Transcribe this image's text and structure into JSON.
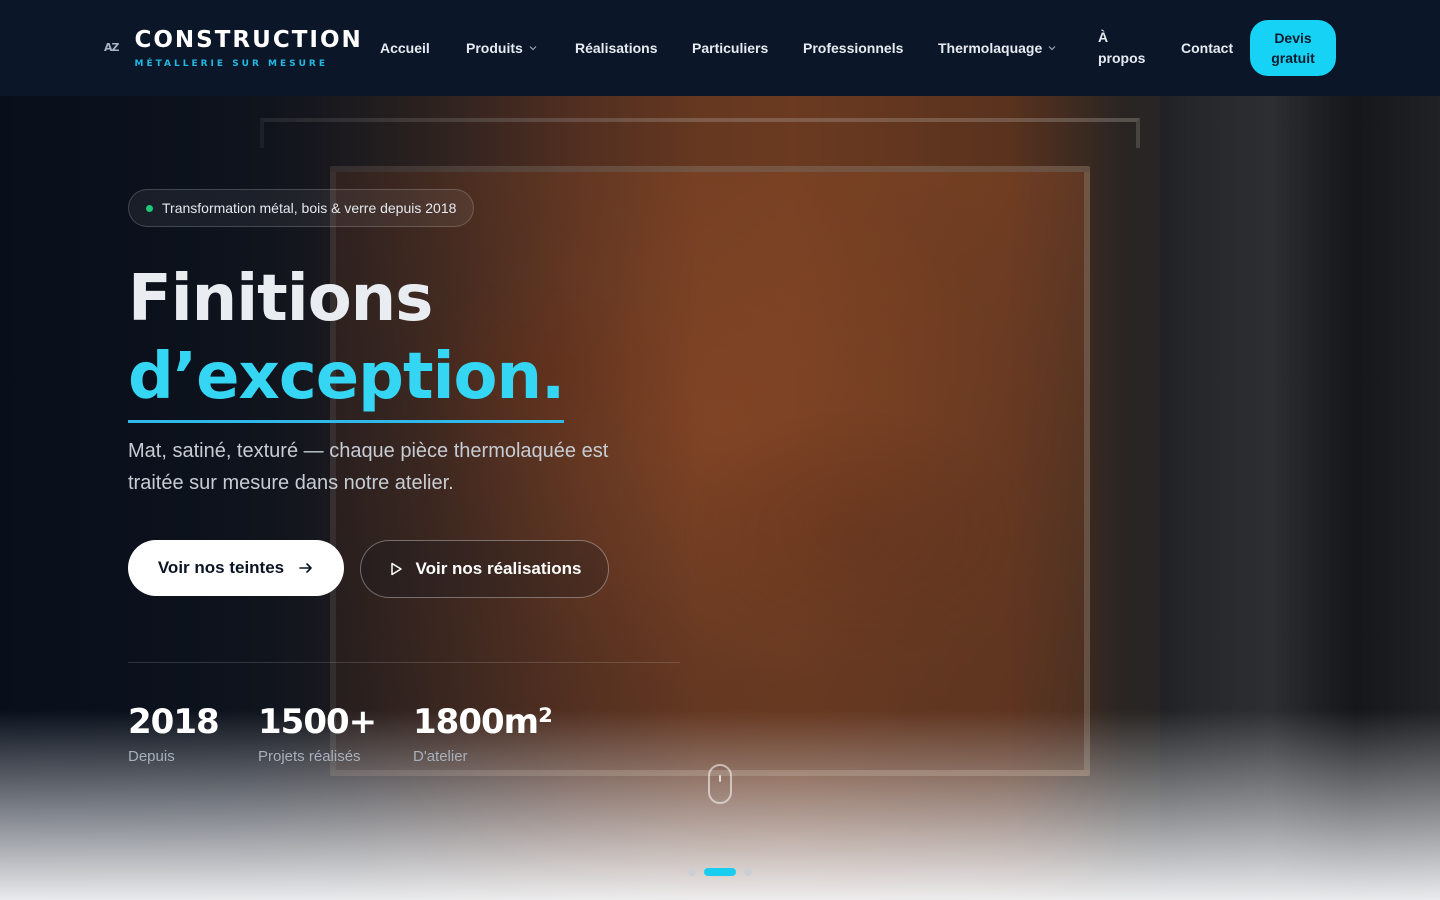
{
  "logo": {
    "mark": "AZ",
    "title": "CONSTRUCTION",
    "subtitle": "MÉTALLERIE SUR MESURE"
  },
  "nav": {
    "items": [
      {
        "label": "Accueil"
      },
      {
        "label": "Produits",
        "dropdown": true
      },
      {
        "label": "Réalisations"
      },
      {
        "label": "Particuliers"
      },
      {
        "label": "Professionnels"
      },
      {
        "label": "Thermolaquage",
        "dropdown": true
      },
      {
        "label_line1": "À",
        "label_line2": "propos"
      },
      {
        "label": "Contact"
      }
    ],
    "cta_line1": "Devis",
    "cta_line2": "gratuit"
  },
  "hero": {
    "badge": "Transformation métal, bois & verre depuis 2018",
    "title_line1": "Finitions",
    "title_line2": "d’exception.",
    "subtitle": "Mat, satiné, texturé — chaque pièce thermolaquée est traitée sur mesure dans notre atelier.",
    "primary_button": "Voir nos teintes",
    "secondary_button": "Voir nos réalisations",
    "stats": [
      {
        "value": "2018",
        "label": "Depuis"
      },
      {
        "value": "1500+",
        "label": "Projets réalisés"
      },
      {
        "value": "1800m²",
        "label": "D'atelier"
      }
    ],
    "slides": {
      "count": 3,
      "active_index": 1
    }
  },
  "colors": {
    "accent": "#16d3f5",
    "header_bg": "#0b1628",
    "badge_dot": "#1fc77a"
  },
  "icons": {
    "arrow": "arrow-right-icon",
    "play": "play-icon",
    "chevron": "chevron-down-icon",
    "scroll": "mouse-scroll-icon"
  }
}
